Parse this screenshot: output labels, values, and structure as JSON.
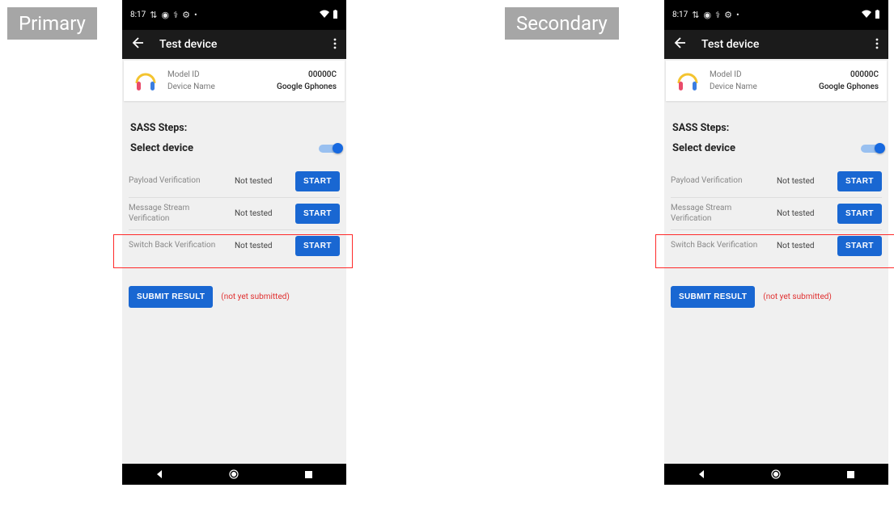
{
  "labels": {
    "primary": "Primary",
    "secondary": "Secondary"
  },
  "status": {
    "time": "8:17",
    "icons_left": [
      "⇅",
      "◉",
      "⚕",
      "⚙",
      "•"
    ],
    "icons_right": [
      "wifi",
      "battery"
    ]
  },
  "appbar": {
    "title": "Test device"
  },
  "card": {
    "rows": [
      {
        "k": "Model ID",
        "v": "00000C"
      },
      {
        "k": "Device Name",
        "v": "Google Gphones"
      }
    ]
  },
  "sass_title": "SASS Steps:",
  "select_label": "Select device",
  "tests": [
    {
      "name": "Payload Verification",
      "status": "Not tested",
      "btn": "START"
    },
    {
      "name": "Message Stream Verification",
      "status": "Not tested",
      "btn": "START"
    },
    {
      "name": "Switch Back Verification",
      "status": "Not tested",
      "btn": "START"
    }
  ],
  "submit": {
    "btn": "SUBMIT RESULT",
    "note": "(not yet submitted)"
  }
}
